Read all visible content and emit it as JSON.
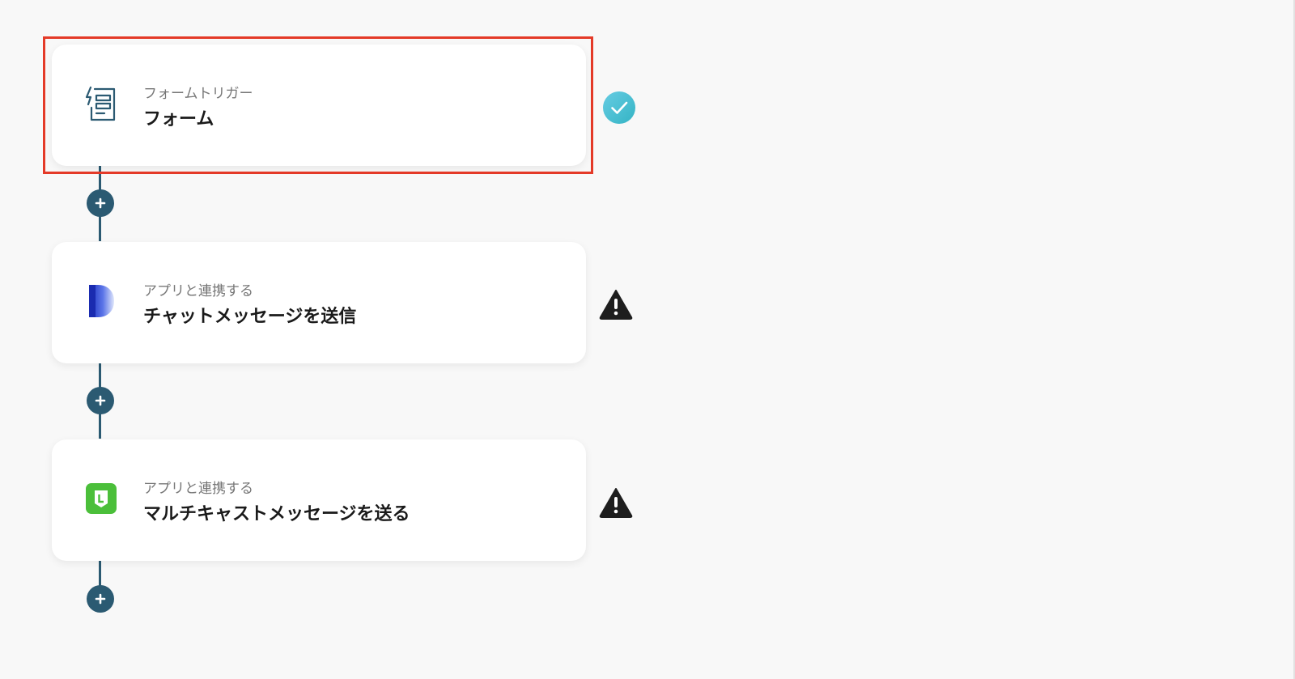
{
  "colors": {
    "accent": "#2b5a72",
    "highlight": "#e43a28",
    "success_start": "#5ec6e0",
    "success_end": "#3ab7c7",
    "warning": "#1e1e1e",
    "line_icon": "#4bbf3a"
  },
  "flow": {
    "steps": [
      {
        "type_label": "フォームトリガー",
        "title": "フォーム",
        "icon": "form-trigger-icon",
        "status": "complete",
        "status_icon": "check-circle-icon"
      },
      {
        "type_label": "アプリと連携する",
        "title": "チャットメッセージを送信",
        "icon": "chat-app-icon",
        "status": "warning",
        "status_icon": "warning-triangle-icon"
      },
      {
        "type_label": "アプリと連携する",
        "title": "マルチキャストメッセージを送る",
        "icon": "line-app-icon",
        "status": "warning",
        "status_icon": "warning-triangle-icon"
      }
    ],
    "add_buttons": [
      {
        "icon": "plus-icon"
      },
      {
        "icon": "plus-icon"
      },
      {
        "icon": "plus-icon"
      }
    ]
  }
}
